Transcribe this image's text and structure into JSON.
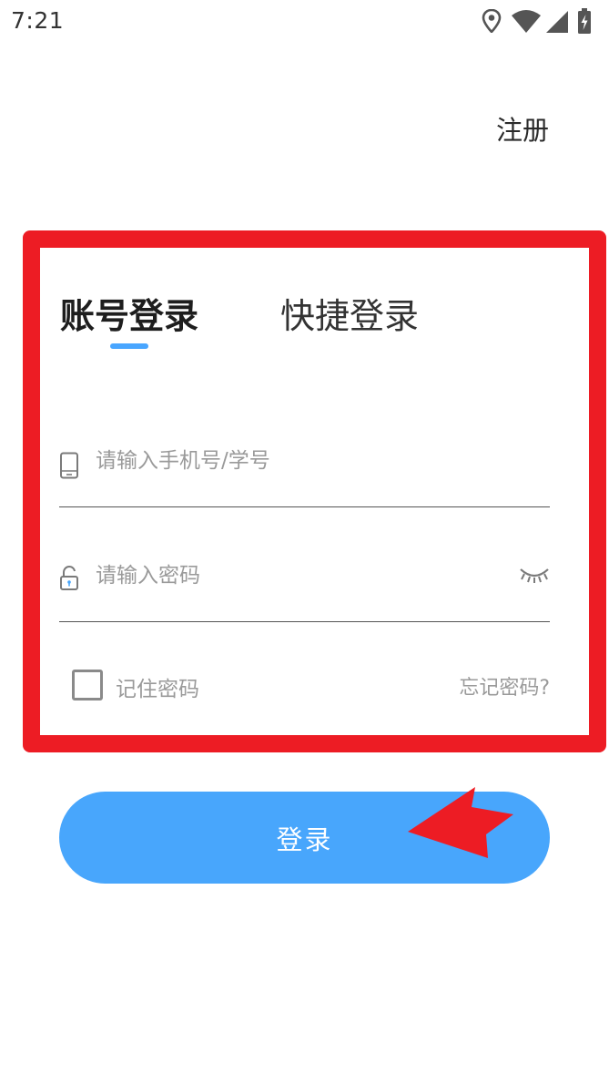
{
  "status_bar": {
    "time": "7:21",
    "icons": [
      "location-icon",
      "wifi-icon",
      "cellular-signal-icon",
      "battery-charging-icon"
    ]
  },
  "header": {
    "register_label": "注册"
  },
  "tabs": [
    {
      "label": "账号登录",
      "active": true
    },
    {
      "label": "快捷登录",
      "active": false
    }
  ],
  "form": {
    "phone": {
      "placeholder": "请输入手机号/学号",
      "value": "",
      "icon": "phone-icon"
    },
    "password": {
      "placeholder": "请输入密码",
      "value": "",
      "icon": "unlocked-padlock-icon",
      "toggle_icon": "eye-closed-icon"
    },
    "remember_label": "记住密码",
    "remember_checked": false,
    "forgot_label": "忘记密码?"
  },
  "login_button": {
    "label": "登录"
  },
  "colors": {
    "accent": "#48a6fc",
    "highlight_annotation": "#ed1c24"
  }
}
